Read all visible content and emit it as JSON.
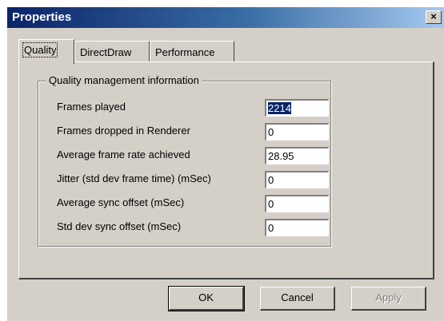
{
  "window": {
    "title": "Properties",
    "close_glyph": "×",
    "close_icon": "close-icon"
  },
  "tabs": [
    {
      "label": "Quality",
      "active": true
    },
    {
      "label": "DirectDraw",
      "active": false
    },
    {
      "label": "Performance",
      "active": false
    }
  ],
  "group": {
    "title": "Quality management information",
    "rows": [
      {
        "label": "Frames played",
        "value": "2214",
        "selected": true
      },
      {
        "label": "Frames dropped in Renderer",
        "value": "0"
      },
      {
        "label": "Average frame rate achieved",
        "value": "28.95"
      },
      {
        "label": "Jitter (std dev frame time) (mSec)",
        "value": "0"
      },
      {
        "label": "Average sync offset (mSec)",
        "value": "0"
      },
      {
        "label": "Std dev sync offset (mSec)",
        "value": "0"
      }
    ]
  },
  "buttons": {
    "ok": "OK",
    "cancel": "Cancel",
    "apply": "Apply",
    "apply_enabled": false
  },
  "colors": {
    "title_gradient_start": "#0a246a",
    "title_gradient_end": "#a6caf0",
    "face": "#d4d0c8",
    "selection": "#0a246a"
  }
}
